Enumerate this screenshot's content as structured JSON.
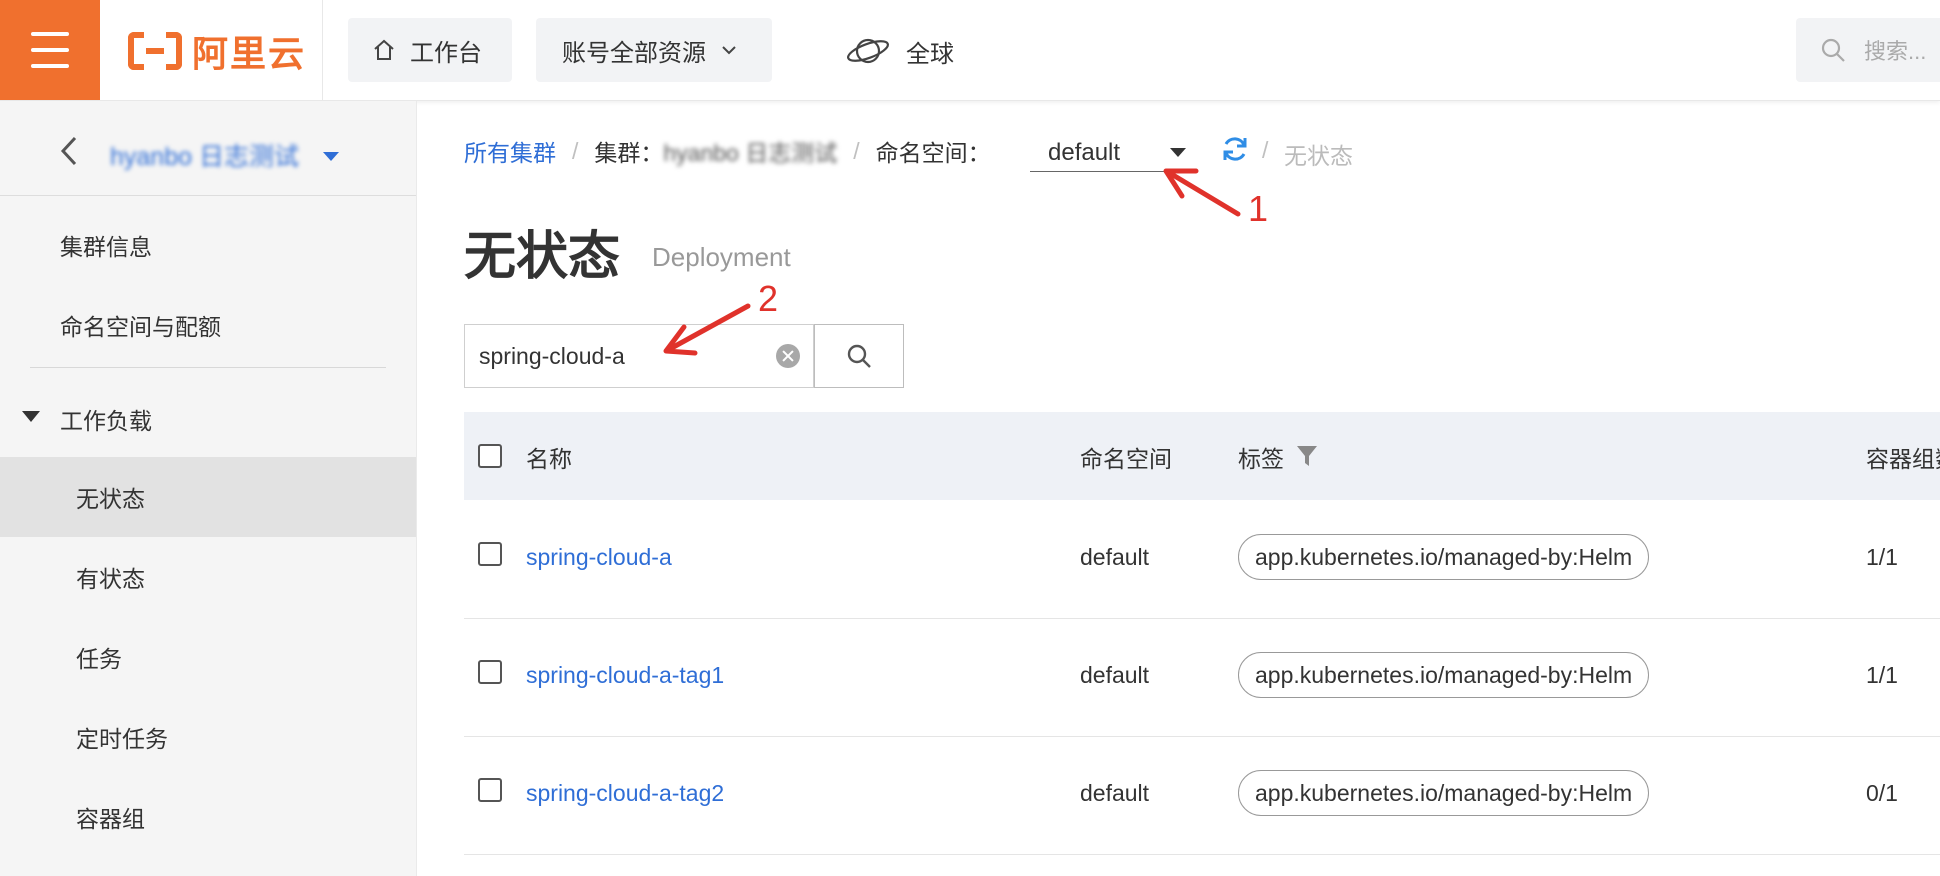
{
  "topbar": {
    "brand": "阿里云",
    "workbench": "工作台",
    "resources": "账号全部资源",
    "region": "全球",
    "search_placeholder": "搜索..."
  },
  "sidebar": {
    "cluster_name": "hyanbo 日志测试",
    "items": [
      {
        "label": "集群信息"
      },
      {
        "label": "命名空间与配额"
      },
      {
        "label": "工作负载"
      },
      {
        "label": "无状态"
      },
      {
        "label": "有状态"
      },
      {
        "label": "任务"
      },
      {
        "label": "定时任务"
      },
      {
        "label": "容器组"
      }
    ]
  },
  "breadcrumb": {
    "all_clusters": "所有集群",
    "cluster_label": "集群：",
    "cluster_value": "hyanbo 日志测试",
    "namespace_label": "命名空间：",
    "namespace_value": "default",
    "current": "无状态"
  },
  "page": {
    "title": "无状态",
    "subtitle": "Deployment"
  },
  "search": {
    "value": "spring-cloud-a"
  },
  "table": {
    "headers": [
      "名称",
      "命名空间",
      "标签",
      "容器组数"
    ],
    "rows": [
      {
        "name": "spring-cloud-a",
        "namespace": "default",
        "label": "app.kubernetes.io/managed-by:Helm",
        "pods": "1/1"
      },
      {
        "name": "spring-cloud-a-tag1",
        "namespace": "default",
        "label": "app.kubernetes.io/managed-by:Helm",
        "pods": "1/1"
      },
      {
        "name": "spring-cloud-a-tag2",
        "namespace": "default",
        "label": "app.kubernetes.io/managed-by:Helm",
        "pods": "0/1"
      }
    ]
  },
  "annotations": {
    "marker1": "1",
    "marker2": "2",
    "color": "#e0322b"
  },
  "colors": {
    "brand": "#f0702e",
    "link": "#2f6ed6"
  }
}
